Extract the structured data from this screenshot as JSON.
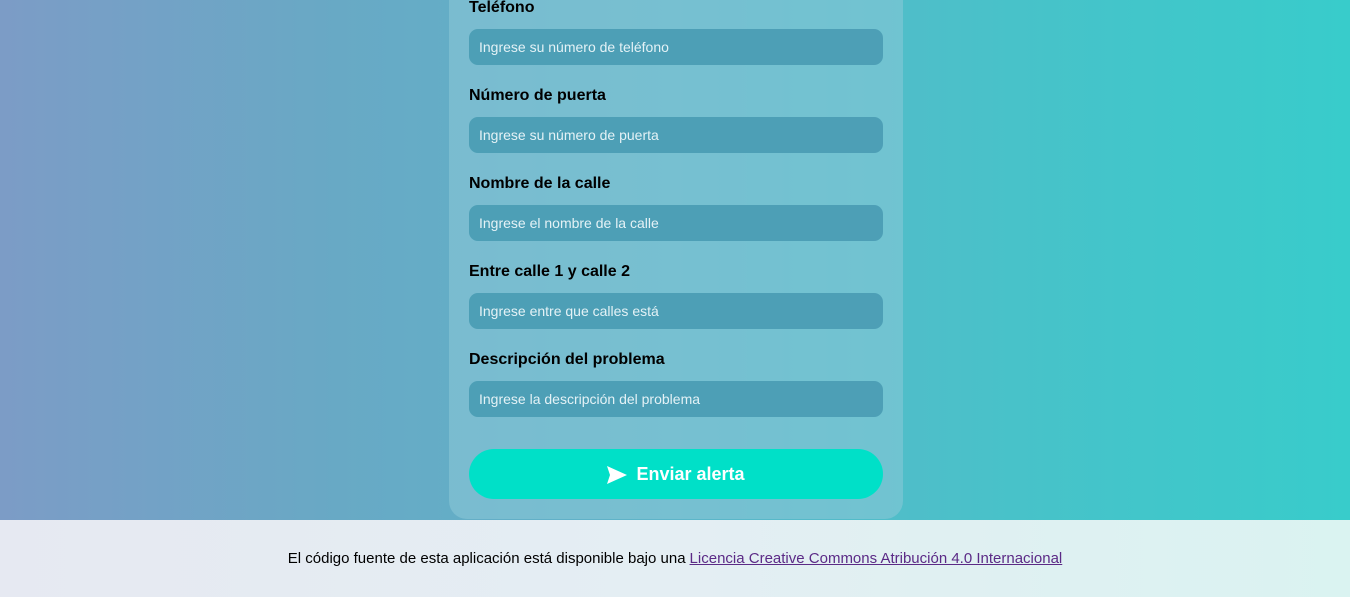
{
  "form": {
    "fields": [
      {
        "label": "Teléfono",
        "placeholder": "Ingrese su número de teléfono"
      },
      {
        "label": "Número de puerta",
        "placeholder": "Ingrese su número de puerta"
      },
      {
        "label": "Nombre de la calle",
        "placeholder": "Ingrese el nombre de la calle"
      },
      {
        "label": "Entre calle 1 y calle 2",
        "placeholder": "Ingrese entre que calles está"
      },
      {
        "label": "Descripción del problema",
        "placeholder": "Ingrese la descripción del problema"
      }
    ],
    "submit": {
      "label": "Enviar alerta",
      "icon": "paper-plane-icon"
    }
  },
  "footer": {
    "text": "El código fuente de esta aplicación está disponible bajo una",
    "link_label": "Licencia Creative Commons Atribución 4.0 Internacional"
  },
  "colors": {
    "accent": "#00e0c8",
    "input_bg": "#4d9fb6",
    "link": "#5b2a86"
  }
}
